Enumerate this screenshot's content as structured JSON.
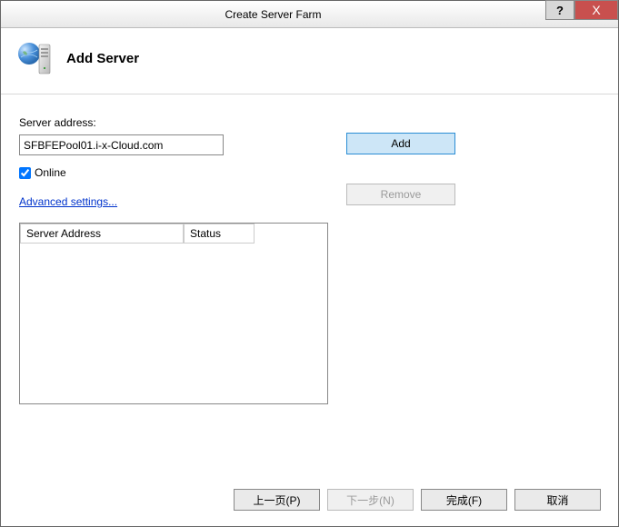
{
  "titlebar": {
    "title": "Create Server Farm",
    "help": "?",
    "close": "X"
  },
  "header": {
    "heading": "Add Server"
  },
  "form": {
    "server_address_label": "Server address:",
    "server_address_value": "SFBFEPool01.i-x-Cloud.com",
    "online_label": "Online",
    "online_checked": true,
    "advanced_link": "Advanced settings..."
  },
  "buttons": {
    "add": "Add",
    "remove": "Remove"
  },
  "table": {
    "col_address": "Server Address",
    "col_status": "Status",
    "rows": []
  },
  "footer": {
    "previous": "上一页(P)",
    "next": "下一步(N)",
    "finish": "完成(F)",
    "cancel": "取消"
  }
}
